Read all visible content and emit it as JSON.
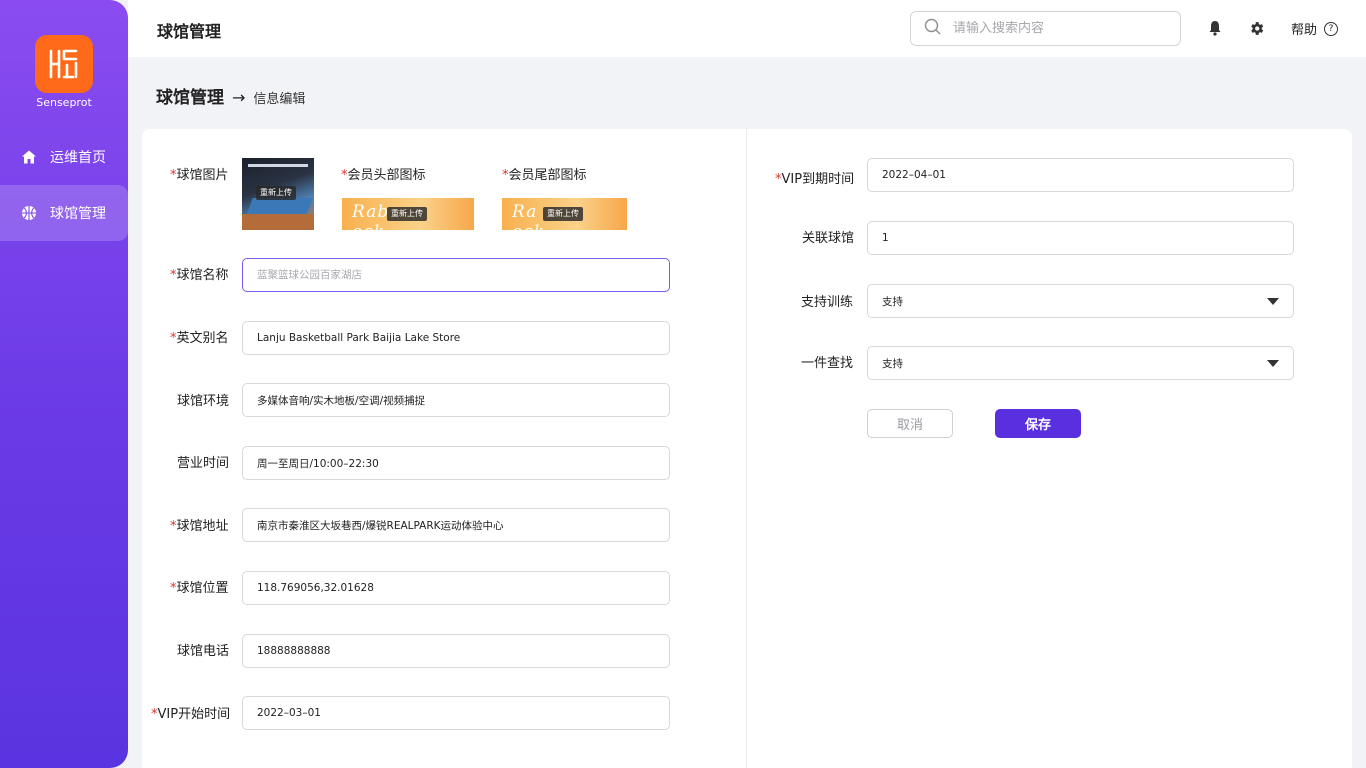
{
  "sidebar": {
    "brand": "Senseprot",
    "items": [
      {
        "label": "运维首页",
        "icon": "home-icon"
      },
      {
        "label": "球馆管理",
        "icon": "basketball-icon"
      }
    ]
  },
  "header": {
    "title": "球馆管理",
    "search_placeholder": "请输入搜索内容",
    "help_label": "帮助",
    "help_icon_glyph": "?"
  },
  "breadcrumb": {
    "main": "球馆管理",
    "arrow": "→",
    "sub": "信息编辑"
  },
  "form_left": {
    "venue_image_label": "球馆图片",
    "member_head_icon_label": "会员头部图标",
    "member_tail_icon_label": "会员尾部图标",
    "reupload_label": "重新上传",
    "banner_text_head": "Rab",
    "banner_text_head_tail": "ock",
    "banner_text_tail": "Ra",
    "banner_text_tail_tail": "ock",
    "name_label": "球馆名称",
    "name_placeholder": "蓝聚篮球公园百家湖店",
    "english_label": "英文别名",
    "english_value": "Lanju Basketball Park Baijia Lake Store",
    "environment_label": "球馆环境",
    "environment_value": "多媒体音响/实木地板/空调/视频捕捉",
    "hours_label": "营业时间",
    "hours_value": "周一至周日/10:00–22:30",
    "address_label": "球馆地址",
    "address_value": "南京市秦淮区大坂巷西/爆锐REALPARK运动体验中心",
    "location_label": "球馆位置",
    "location_value": "118.769056,32.01628",
    "phone_label": "球馆电话",
    "phone_value": "18888888888",
    "vip_start_label": "VIP开始时间",
    "vip_start_value": "2022–03–01"
  },
  "form_right": {
    "vip_end_label": "VIP到期时间",
    "vip_end_value": "2022–04–01",
    "linked_venue_label": "关联球馆",
    "linked_venue_value": "1",
    "training_label": "支持训练",
    "training_value": "支持",
    "lookup_label": "一件查找",
    "lookup_value": "支持",
    "cancel_label": "取消",
    "save_label": "保存"
  },
  "required_mark": "*",
  "colors": {
    "accent": "#5a2fe0",
    "logo": "#ff6a1a",
    "required": "#e0322e"
  }
}
